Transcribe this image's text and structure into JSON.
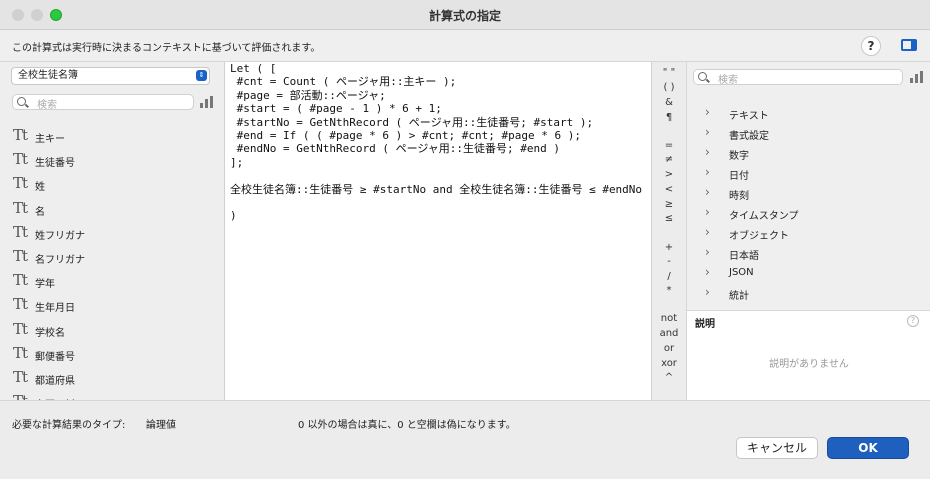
{
  "window": {
    "title": "計算式の指定"
  },
  "info": {
    "text": "この計算式は実行時に決まるコンテキストに基づいて評価されます。",
    "help": "?"
  },
  "left": {
    "table_select": "全校生徒名簿",
    "search_placeholder": "検索",
    "fields": [
      "主キー",
      "生徒番号",
      "姓",
      "名",
      "姓フリガナ",
      "名フリガナ",
      "学年",
      "生年月日",
      "学校名",
      "郵便番号",
      "都道府県",
      "市区町村"
    ],
    "field_icon": "Tt"
  },
  "editor": {
    "lines": [
      "Let ( [",
      " #cnt = Count ( ページャ用::主キー );",
      " #page = 部活動::ページャ;",
      " #start = ( #page - 1 ) * 6 + 1;",
      " #startNo = GetNthRecord ( ページャ用::生徒番号; #start );",
      " #end = If ( ( #page * 6 ) > #cnt; #cnt; #page * 6 );",
      " #endNo = GetNthRecord ( ページャ用::生徒番号; #end )",
      "];",
      "",
      "全校生徒名簿::生徒番号 ≥ #startNo and 全校生徒名簿::生徒番号 ≤ #endNo",
      "",
      ")"
    ]
  },
  "operators": [
    "\" \"",
    "( )",
    "&",
    "¶",
    "=",
    "≠",
    ">",
    "<",
    "≥",
    "≤",
    "+",
    "-",
    "/",
    "*",
    "not",
    "and",
    "or",
    "xor",
    "^"
  ],
  "right": {
    "search_placeholder": "検索",
    "categories": [
      "テキスト",
      "書式設定",
      "数字",
      "日付",
      "時刻",
      "タイムスタンプ",
      "オブジェクト",
      "日本語",
      "JSON",
      "統計"
    ],
    "description_header": "説明",
    "description_empty": "説明がありません"
  },
  "bottom": {
    "result_type_label": "必要な計算結果のタイプ:",
    "result_type_value": "論理値",
    "result_note": "0 以外の場合は真に、0 と空欄は偽になります。",
    "cancel": "キャンセル",
    "ok": "OK"
  },
  "colors": {
    "accent": "#1f5fbe",
    "zoom_button": "#2bc840"
  }
}
